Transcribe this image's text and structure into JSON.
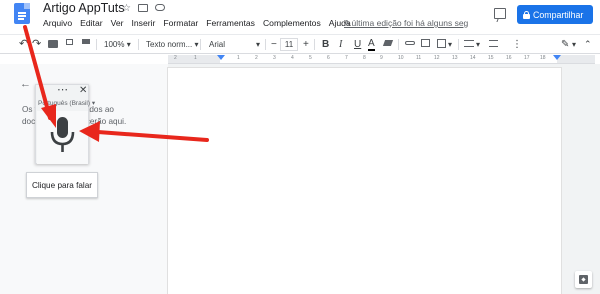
{
  "header": {
    "title": "Artigo AppTuts",
    "menus": [
      "Arquivo",
      "Editar",
      "Ver",
      "Inserir",
      "Formatar",
      "Ferramentas",
      "Complementos",
      "Ajuda"
    ],
    "last_edit": "A última edição foi há alguns segu...",
    "share_label": "Compartilhar",
    "icons": [
      "docs-logo-icon",
      "star-icon",
      "folder-icon",
      "cloud-icon",
      "comment-icon",
      "lock-icon"
    ],
    "colors": {
      "share_bg": "#1a73e8",
      "docs_blue": "#4285f4"
    }
  },
  "toolbar": {
    "zoom": "100%",
    "style": "Texto norm...",
    "font": "Arial",
    "font_size": "11",
    "minus": "−",
    "plus": "+",
    "bold": "B",
    "italic": "I",
    "underline": "U",
    "text_color": "A",
    "caret": "▾",
    "more": "⋮",
    "icons": [
      "undo-icon",
      "redo-icon",
      "print-icon",
      "paint-format-icon",
      "highlight-icon",
      "link-icon",
      "add-comment-icon",
      "image-icon",
      "align-icon",
      "line-spacing-icon",
      "edit-mode-icon",
      "collapse-icon"
    ]
  },
  "ruler": {
    "numbers": [
      "2",
      "1",
      "1",
      "2",
      "3",
      "4",
      "5",
      "6",
      "7",
      "8",
      "9",
      "10",
      "11",
      "12",
      "13",
      "14",
      "15",
      "16",
      "17",
      "18"
    ]
  },
  "sidebar": {
    "back": "←",
    "outline_text": "Os títulos adicionados ao documento aparecerão aqui."
  },
  "voice": {
    "dots": "⋯",
    "close": "✕",
    "language": "Português (Brasil) ▾",
    "tooltip": "Clique para falar",
    "colors": {
      "mic": "#3c4043",
      "arrow": "#e8271c"
    }
  }
}
